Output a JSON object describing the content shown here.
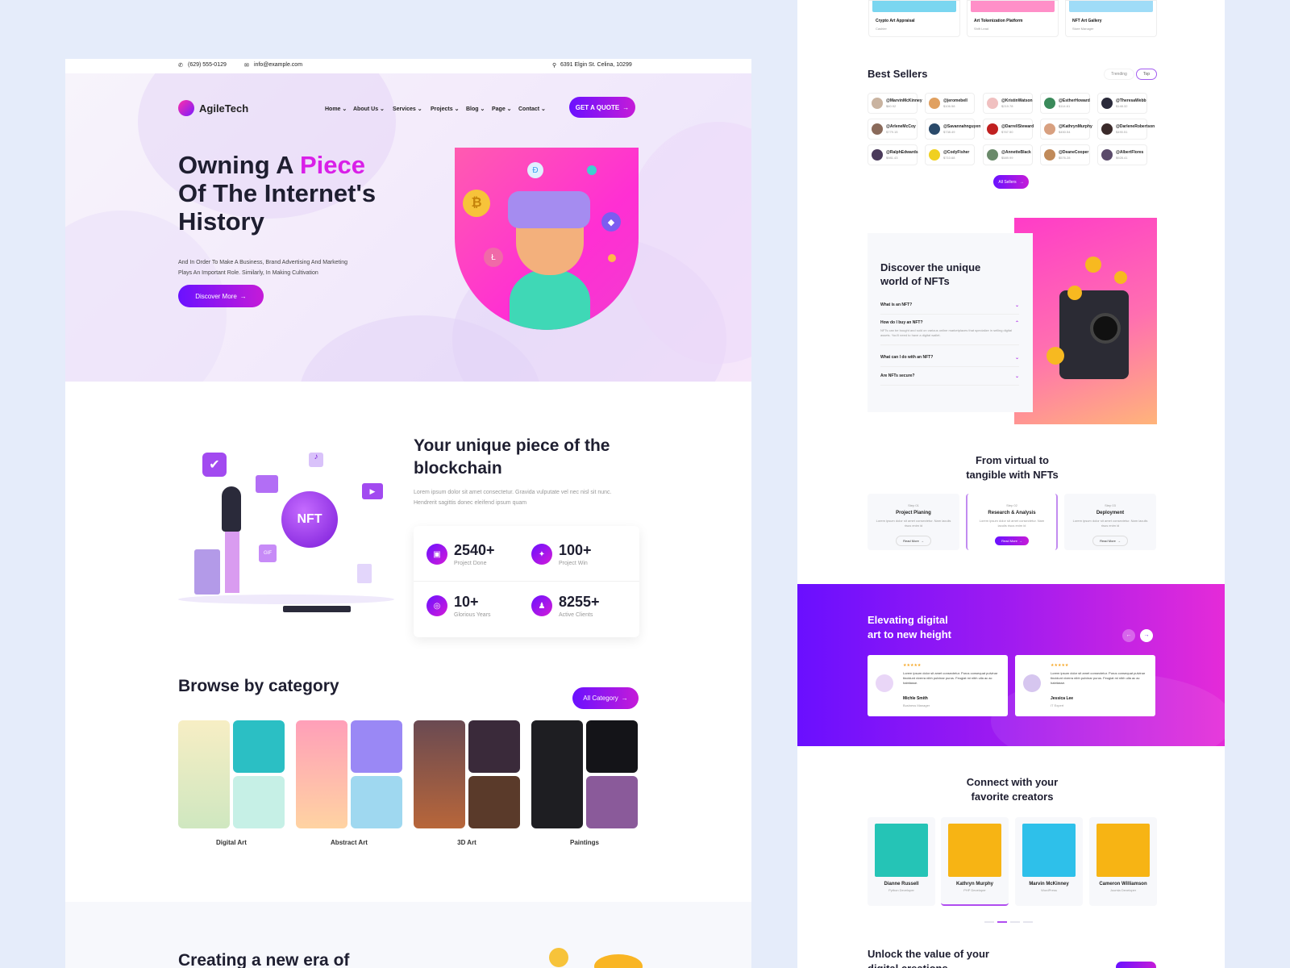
{
  "left": {
    "topbar": {
      "phone": "(629) 555-0129",
      "email": "info@example.com",
      "address": "6391 Elgin St. Celina, 10299"
    },
    "logo": "AgileTech",
    "nav": [
      "Home",
      "About Us",
      "Services",
      "Projects",
      "Blog",
      "Page",
      "Contact"
    ],
    "quote_button": "GET A QUOTE",
    "hero": {
      "title_a": "Owning A ",
      "title_highlight": "Piece",
      "title_b": "Of The Internet's",
      "title_c": "History",
      "subtitle_1": "And In Order To Make A Business, Brand Advertising And Marketing",
      "subtitle_2": "Plays An Important Role. Similarly, In Making Cultivation",
      "cta": "Discover More"
    },
    "blockchain": {
      "title_1": "Your unique piece of the",
      "title_2": "blockchain",
      "text_1": "Lorem ipsum dolor sit amet consectetur. Gravida vulputate vel nec nisl sit nunc.",
      "text_2": "Hendrerit sagittis donec eleifend ipsum quam",
      "illustration_label": "NFT",
      "gif_label": "GIF",
      "stats": [
        {
          "num": "2540+",
          "label": "Project Done"
        },
        {
          "num": "100+",
          "label": "Project Win"
        },
        {
          "num": "10+",
          "label": "Glorious Years"
        },
        {
          "num": "8255+",
          "label": "Active Clients"
        }
      ]
    },
    "category": {
      "title": "Browse by category",
      "button": "All Category",
      "items": [
        "Digital Art",
        "Abstract Art",
        "3D Art",
        "Paintings"
      ]
    },
    "next_title": "Creating a new era of"
  },
  "right": {
    "top_cards": [
      {
        "title": "Crypto Art Appraisal",
        "role": "Cashier"
      },
      {
        "title": "Art Tokenization Platform",
        "role": "Shift Lead"
      },
      {
        "title": "NFT Art Gallery",
        "role": "Store Manager"
      }
    ],
    "best_sellers": {
      "title": "Best Sellers",
      "tabs": [
        "Trending",
        "Top"
      ],
      "sellers": [
        {
          "name": "@MarvinMcKinney",
          "price": "$60.92"
        },
        {
          "name": "@jeromebell",
          "price": "$106.58"
        },
        {
          "name": "@KristinWatson",
          "price": "$219.78"
        },
        {
          "name": "@EstherHoward",
          "price": "$114.61"
        },
        {
          "name": "@TheresaWebb",
          "price": "$148.32"
        },
        {
          "name": "@ArleneMcCoy",
          "price": "$779.15"
        },
        {
          "name": "@Savannahnguyen",
          "price": "$738.49"
        },
        {
          "name": "@DarrellSteward",
          "price": "$767.50"
        },
        {
          "name": "@KathrynMurphy",
          "price": "$450.54"
        },
        {
          "name": "@DarleneRobertson",
          "price": "$490.51"
        },
        {
          "name": "@RalphEdwards",
          "price": "$981.43"
        },
        {
          "name": "@CodyFisher",
          "price": "$710.68"
        },
        {
          "name": "@AnnetteBlack",
          "price": "$589.99"
        },
        {
          "name": "@DeaneCooper",
          "price": "$576.28"
        },
        {
          "name": "@AlbertFlores",
          "price": "$928.41"
        }
      ],
      "button": "All Sellers"
    },
    "faq": {
      "title_1": "Discover the unique",
      "title_2": "world of NFTs",
      "items": [
        {
          "q": "What is an NFT?",
          "a": ""
        },
        {
          "q": "How do I buy an NFT?",
          "a": "NFTs can be bought and sold on various online marketplaces that specialize in selling digital assets. You'll need to have a digital wallet."
        },
        {
          "q": "What can I do with an NFT?",
          "a": ""
        },
        {
          "q": "Are NFTs secure?",
          "a": ""
        }
      ]
    },
    "steps": {
      "title_1": "From virtual to",
      "title_2": "tangible with NFTs",
      "items": [
        {
          "num": "Step 01",
          "title": "Project Planing",
          "desc": "Lorem ipsum dolor sit amet consectetur. Nam iaculis risus enim id",
          "btn": "Read More"
        },
        {
          "num": "Step 02",
          "title": "Research & Analysis",
          "desc": "Lorem ipsum dolor sit amet consectetur. Nam iaculis risus enim id",
          "btn": "Read More"
        },
        {
          "num": "Step 03",
          "title": "Deployment",
          "desc": "Lorem ipsum dolor sit amet consectetur. Nam iaculis risus enim id",
          "btn": "Read More"
        }
      ]
    },
    "testimonials": {
      "title_1": "Elevating digital",
      "title_2": "art to new height",
      "stars": "★★★★★",
      "items": [
        {
          "text": "Lorem ipsum dolor sit amet consectetur. Purus consequat pulvinar tincidunt viverra nibh pulvinar purus. Feugiat mi nibh ulla ac ac habitasse.",
          "name": "Michle Smith",
          "role": "Business Manager"
        },
        {
          "text": "Lorem ipsum dolor sit amet consectetur. Purus consequat pulvinar tincidunt viverra nibh pulvinar purus. Feugiat mi nibh ulla ac ac habitasse.",
          "name": "Jessica Lee",
          "role": "IT Expert"
        }
      ]
    },
    "creators": {
      "title_1": "Connect with your",
      "title_2": "favorite creators",
      "items": [
        {
          "name": "Dianne Russell",
          "role": "Python Developer"
        },
        {
          "name": "Kathryn Murphy",
          "role": "PHP Developer"
        },
        {
          "name": "Marvin McKinney",
          "role": "WordPress"
        },
        {
          "name": "Cameron Williamson",
          "role": "Joomla Developer"
        }
      ]
    },
    "bottom_title": "Unlock the value of your",
    "bottom_title_2": "digital creations"
  }
}
